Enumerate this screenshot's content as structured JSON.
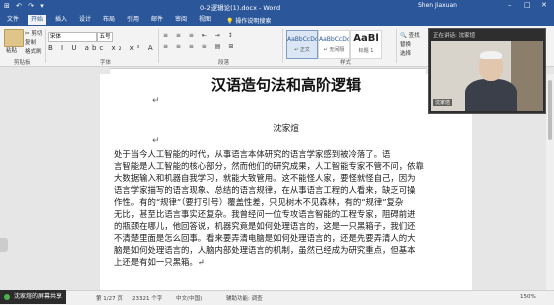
{
  "titlebar": {
    "quick_access": "⊞ ↶ ↷ ▾",
    "doc_title": "0-2逻辑论(1).docx - Word",
    "user": "Shen Jiaxuan",
    "min": "–",
    "max": "□",
    "close": "✕"
  },
  "tabs": [
    "文件",
    "开始",
    "插入",
    "设计",
    "布局",
    "引用",
    "邮件",
    "审阅",
    "视图",
    "帮助"
  ],
  "active_tab": "开始",
  "tell_me": "操作说明搜索",
  "ribbon": {
    "clipboard": {
      "paste": "粘贴",
      "cut": "✂ 剪切",
      "copy": "复制",
      "painter": "格式刷",
      "label": "剪贴板"
    },
    "font": {
      "name": "宋体",
      "size": "五号",
      "format_row": "B I U abc x₂ x² A",
      "label": "字体"
    },
    "paragraph": {
      "row1": "≡ ≡ ≡ ⇤ ⇥ ↕",
      "row2": "≡ ≡ ≡ ≡ ▤ ⊞",
      "label": "段落"
    },
    "styles": {
      "items": [
        {
          "sample": "AaBbCcDc",
          "name": "↵ 正文",
          "selected": true
        },
        {
          "sample": "AaBbCcDc",
          "name": "↵ 无间隔",
          "selected": false
        },
        {
          "sample": "AaBl",
          "name": "标题 1",
          "selected": false
        }
      ],
      "label": "样式"
    },
    "editing": {
      "find": "🔍 查找",
      "replace": "替换",
      "select": "选择",
      "label": "编辑"
    }
  },
  "document": {
    "title": "汉语造句法和高阶逻辑",
    "author": "沈家煊",
    "lines": [
      "    处于当今人工智能的时代，从事语言本体研究的语言学家感到被冷落了。语",
      "言智能是人工智能的核心部分，然而他们的研究成果，人工智能专家不管不问，依靠",
      "大数据输入和机器自我学习，就能大致管用。这不能怪人家，要怪就怪自己，因为",
      "语言学家描写的语言现象、总结的语言规律，在从事语言工程的人看来，缺乏可操",
      "作性。有的“规律”（要打引号）覆盖性差，只见树木不见森林，有的“规律”复杂",
      "无比，甚至比语言事实还复杂。我曾经问一位专攻语言智能的工程专家，阻碍前进",
      "的瓶颈在哪儿，他回答说，机器究竟是如何处理语言的，这是一只黑箱子，我们还",
      "不清楚里面是怎么回事。看来要弄清电脑是如何处理语言的，还是先要弄清人的大",
      "脑是如何处理语言的，人脑内部处理语言的机制，虽然已经成为研究重点，但基本",
      "上还是有如一只黑箱。↵"
    ]
  },
  "video": {
    "title": "正在讲话: 沈家煊",
    "name": "沈家煊"
  },
  "statusbar": {
    "share": "沈家煊的屏幕共享",
    "page": "第 1/27 页",
    "words": "23321 个字",
    "lang": "中文(中国)",
    "a11y": "辅助功能: 调查",
    "zoom": "150%"
  },
  "colors": {
    "accent": "#2b579a"
  }
}
